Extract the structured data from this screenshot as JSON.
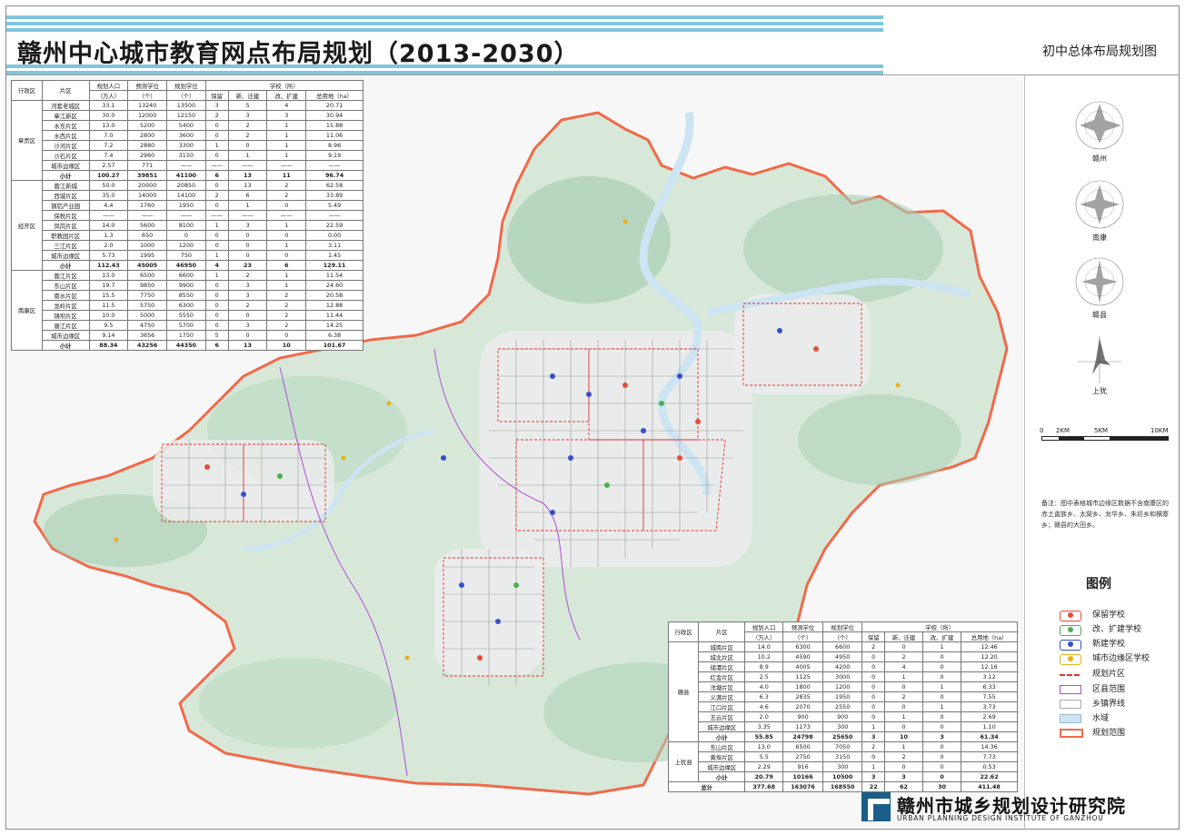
{
  "header": {
    "title": "赣州中心城市教育网点布局规划（2013-2030）",
    "subtitle": "初中总体布局规划图"
  },
  "table_north": {
    "headers": {
      "district": "行政区",
      "area": "片区",
      "population": "规划人口",
      "population_unit": "（万人）",
      "forecast": "预测学位",
      "forecast_unit": "（个）",
      "planned": "规划学位",
      "planned_unit": "（个）",
      "schools": "学校（所）",
      "keep": "保留",
      "new": "新、迁建",
      "renovate": "改、扩建",
      "land": "总用地（ha）"
    },
    "groups": [
      {
        "district": "章贡区",
        "rows": [
          [
            "河套老城区",
            "33.1",
            "13240",
            "13500",
            "3",
            "5",
            "4",
            "20.71"
          ],
          [
            "章江新区",
            "30.0",
            "12000",
            "12150",
            "2",
            "3",
            "3",
            "30.94"
          ],
          [
            "水东片区",
            "13.0",
            "5200",
            "5400",
            "0",
            "2",
            "1",
            "15.88"
          ],
          [
            "水西片区",
            "7.0",
            "2800",
            "3600",
            "0",
            "2",
            "1",
            "11.06"
          ],
          [
            "沙河片区",
            "7.2",
            "2880",
            "3300",
            "1",
            "0",
            "1",
            "8.96"
          ],
          [
            "沙石片区",
            "7.4",
            "2960",
            "3150",
            "0",
            "1",
            "1",
            "9.19"
          ],
          [
            "城市边缘区",
            "2.57",
            "771",
            "——",
            "——",
            "——",
            "——",
            "——"
          ]
        ],
        "subtotal": [
          "小计",
          "100.27",
          "39851",
          "41100",
          "6",
          "13",
          "11",
          "96.74"
        ]
      },
      {
        "district": "经开区",
        "rows": [
          [
            "蓉江新城",
            "50.0",
            "20000",
            "20850",
            "0",
            "13",
            "2",
            "62.58"
          ],
          [
            "西城片区",
            "35.0",
            "14000",
            "14100",
            "2",
            "6",
            "2",
            "33.89"
          ],
          [
            "钢铝产业园",
            "4.4",
            "1760",
            "1950",
            "0",
            "1",
            "0",
            "5.49"
          ],
          [
            "保税片区",
            "——",
            "——",
            "——",
            "——",
            "——",
            "——",
            "——"
          ],
          [
            "凤岗片区",
            "14.0",
            "5600",
            "8100",
            "1",
            "3",
            "1",
            "22.59"
          ],
          [
            "职教园片区",
            "1.3",
            "650",
            "0",
            "0",
            "0",
            "0",
            "0.00"
          ],
          [
            "三江片区",
            "2.0",
            "1000",
            "1200",
            "0",
            "0",
            "1",
            "3.11"
          ],
          [
            "城市边缘区",
            "5.73",
            "1995",
            "750",
            "1",
            "0",
            "0",
            "1.45"
          ]
        ],
        "subtotal": [
          "小计",
          "112.43",
          "45005",
          "46950",
          "4",
          "23",
          "6",
          "129.11"
        ]
      },
      {
        "district": "南康区",
        "rows": [
          [
            "蓉江片区",
            "13.0",
            "6500",
            "6600",
            "1",
            "2",
            "1",
            "11.54"
          ],
          [
            "东山片区",
            "19.7",
            "9850",
            "9900",
            "0",
            "3",
            "1",
            "24.60"
          ],
          [
            "南水片区",
            "15.5",
            "7750",
            "8550",
            "0",
            "3",
            "2",
            "20.58"
          ],
          [
            "龙岭片区",
            "11.5",
            "5750",
            "6300",
            "0",
            "2",
            "2",
            "12.88"
          ],
          [
            "镜坝片区",
            "10.0",
            "5000",
            "5550",
            "0",
            "0",
            "2",
            "11.44"
          ],
          [
            "唐江片区",
            "9.5",
            "4750",
            "5700",
            "0",
            "3",
            "2",
            "14.25"
          ],
          [
            "城市边缘区",
            "9.14",
            "3656",
            "1750",
            "5",
            "0",
            "0",
            "6.38"
          ]
        ],
        "subtotal": [
          "小计",
          "88.34",
          "43256",
          "44350",
          "6",
          "13",
          "10",
          "101.67"
        ]
      }
    ]
  },
  "table_south": {
    "groups": [
      {
        "district": "赣县",
        "rows": [
          [
            "城南片区",
            "14.0",
            "6300",
            "6600",
            "2",
            "0",
            "1",
            "12.46"
          ],
          [
            "城北片区",
            "10.2",
            "4590",
            "4950",
            "0",
            "2",
            "0",
            "12.20"
          ],
          [
            "储潭片区",
            "8.9",
            "4005",
            "4200",
            "0",
            "4",
            "0",
            "12.16"
          ],
          [
            "红金片区",
            "2.5",
            "1125",
            "3000",
            "0",
            "1",
            "0",
            "3.12"
          ],
          [
            "洋塘片区",
            "4.0",
            "1800",
            "1200",
            "0",
            "0",
            "1",
            "6.33"
          ],
          [
            "义源片区",
            "6.3",
            "2835",
            "1950",
            "0",
            "2",
            "0",
            "7.55"
          ],
          [
            "江口片区",
            "4.6",
            "2070",
            "2550",
            "0",
            "0",
            "1",
            "3.73"
          ],
          [
            "五云片区",
            "2.0",
            "900",
            "900",
            "0",
            "1",
            "0",
            "2.69"
          ],
          [
            "城市边缘区",
            "3.35",
            "1173",
            "300",
            "1",
            "0",
            "0",
            "1.10"
          ]
        ],
        "subtotal": [
          "小计",
          "55.85",
          "24798",
          "25650",
          "3",
          "10",
          "3",
          "61.34"
        ]
      },
      {
        "district": "上犹县",
        "rows": [
          [
            "东山片区",
            "13.0",
            "6500",
            "7050",
            "2",
            "1",
            "0",
            "14.36"
          ],
          [
            "黄埠片区",
            "5.5",
            "2750",
            "3150",
            "0",
            "2",
            "0",
            "7.73"
          ],
          [
            "城市边缘区",
            "2.29",
            "916",
            "300",
            "1",
            "0",
            "0",
            "0.53"
          ]
        ],
        "subtotal": [
          "小计",
          "20.79",
          "10166",
          "10500",
          "3",
          "3",
          "0",
          "22.62"
        ]
      }
    ],
    "total": [
      "总计",
      "377.68",
      "163076",
      "168550",
      "22",
      "62",
      "30",
      "411.48"
    ]
  },
  "wind_roses": [
    {
      "label": "赣州"
    },
    {
      "label": "南康"
    },
    {
      "label": "赣县"
    },
    {
      "label": "上犹"
    }
  ],
  "scale": {
    "labels": [
      "0",
      "2KM",
      "5KM",
      "10KM"
    ]
  },
  "note": "备注：图中表格城市边缘区数据不含南康区的赤土畲族乡、太窝乡、龙华乡、朱坊乡和横寨乡；赣县的大田乡。",
  "legend": {
    "title": "图例",
    "items": [
      {
        "label": "保留学校",
        "icon": "red-school-icon",
        "color": "#e64b3c"
      },
      {
        "label": "改、扩建学校",
        "icon": "green-school-icon",
        "color": "#4caf50"
      },
      {
        "label": "新建学校",
        "icon": "blue-school-icon",
        "color": "#3a4fc7"
      },
      {
        "label": "城市边缘区学校",
        "icon": "yellow-school-icon",
        "color": "#e8b020"
      },
      {
        "label": "规划片区",
        "icon": "red-dashed-line-icon",
        "color": "#e23030"
      },
      {
        "label": "区县范围",
        "icon": "purple-line-icon",
        "color": "#b04bd6"
      },
      {
        "label": "乡镇界线",
        "icon": "grey-line-icon",
        "color": "#aaaaaa"
      },
      {
        "label": "水域",
        "icon": "water-icon",
        "color": "#cde4f3"
      },
      {
        "label": "规划范围",
        "icon": "orange-line-icon",
        "color": "#f06a4a"
      }
    ]
  },
  "institute": {
    "name": "赣州市城乡规划设计研究院",
    "english": "URBAN PLANNING DESIGN INSTITUTE OF GANZHOU"
  },
  "map": {
    "boundary_color": "#f06a4a",
    "terrain_color": "#a9cfb4",
    "road_color": "#9a9a9a"
  }
}
